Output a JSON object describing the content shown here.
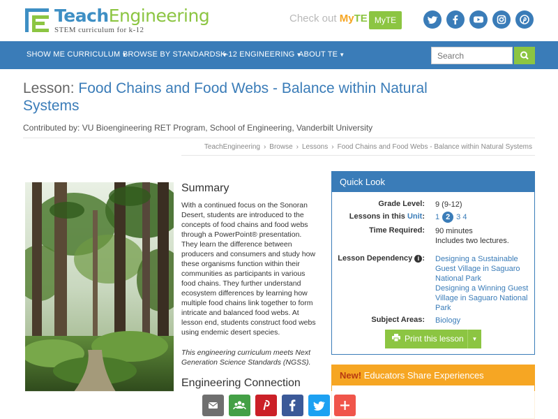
{
  "header": {
    "brand_teach": "Teach",
    "brand_engineering": "Engineering",
    "tagline": "STEM curriculum for k-12",
    "checkout_prefix": "Check out",
    "checkout_my": "My",
    "checkout_te": "TE",
    "myte_button": "MyTE",
    "social": [
      "twitter-icon",
      "facebook-icon",
      "youtube-icon",
      "instagram-icon",
      "pinterest-icon"
    ]
  },
  "nav": {
    "items": [
      "SHOW ME CURRICULUM",
      "BROWSE BY STANDARDS",
      "K-12 ENGINEERING",
      "ABOUT TE"
    ],
    "search_placeholder": "Search"
  },
  "lesson": {
    "label": "Lesson:",
    "title": "Food Chains and Food Webs - Balance within Natural Systems",
    "contributed": "Contributed by: VU Bioengineering RET Program, School of Engineering, Vanderbilt University"
  },
  "breadcrumb": [
    "TeachEngineering",
    "Browse",
    "Lessons",
    "Food Chains and Food Webs - Balance within Natural Systems"
  ],
  "summary": {
    "heading": "Summary",
    "text": "With a continued focus on the Sonoran Desert, students are introduced to the concepts of food chains and food webs through a PowerPoint® presentation. They learn the difference between producers and consumers and study how these organisms function within their communities as participants in various food chains. They further understand ecosystem differences by learning how multiple food chains link together to form intricate and balanced food webs. At lesson end, students construct food webs using endemic desert species.",
    "ngss_note": "This engineering curriculum meets Next Generation Science Standards (NGSS).",
    "eng_heading": "Engineering Connection"
  },
  "quick_look": {
    "heading": "Quick Look",
    "grade_label": "Grade Level:",
    "grade_value": "9 (9-12)",
    "unit_label_pre": "Lessons in this",
    "unit_label_link": "Unit",
    "unit_label_post": ":",
    "unit_lessons": [
      "1",
      "2",
      "3",
      "4"
    ],
    "unit_current": "2",
    "time_label": "Time Required:",
    "time_value": "90 minutes",
    "time_note": "Includes two lectures.",
    "dependency_label": "Lesson Dependency",
    "dependency_1": "Designing a Sustainable Guest Village in Saguaro National Park",
    "dependency_2": "Designing a Winning Guest Village in Saguaro National Park",
    "subject_label": "Subject Areas:",
    "subject_value": "Biology",
    "print_button": "Print this lesson"
  },
  "educators": {
    "new_label": "New!",
    "heading": "Educators Share Experiences"
  },
  "share_bar": [
    {
      "icon": "email-icon",
      "color": "#6f6f6f"
    },
    {
      "icon": "share-icon",
      "color": "#44a046"
    },
    {
      "icon": "pinterest-icon",
      "color": "#cb2027"
    },
    {
      "icon": "facebook-icon",
      "color": "#3b5998"
    },
    {
      "icon": "twitter-icon",
      "color": "#1da1f2"
    },
    {
      "icon": "more-icon",
      "color": "#f0554a"
    }
  ],
  "colors": {
    "primary_blue": "#3a7cb8",
    "accent_green": "#8cc542",
    "accent_orange": "#f6a623"
  }
}
